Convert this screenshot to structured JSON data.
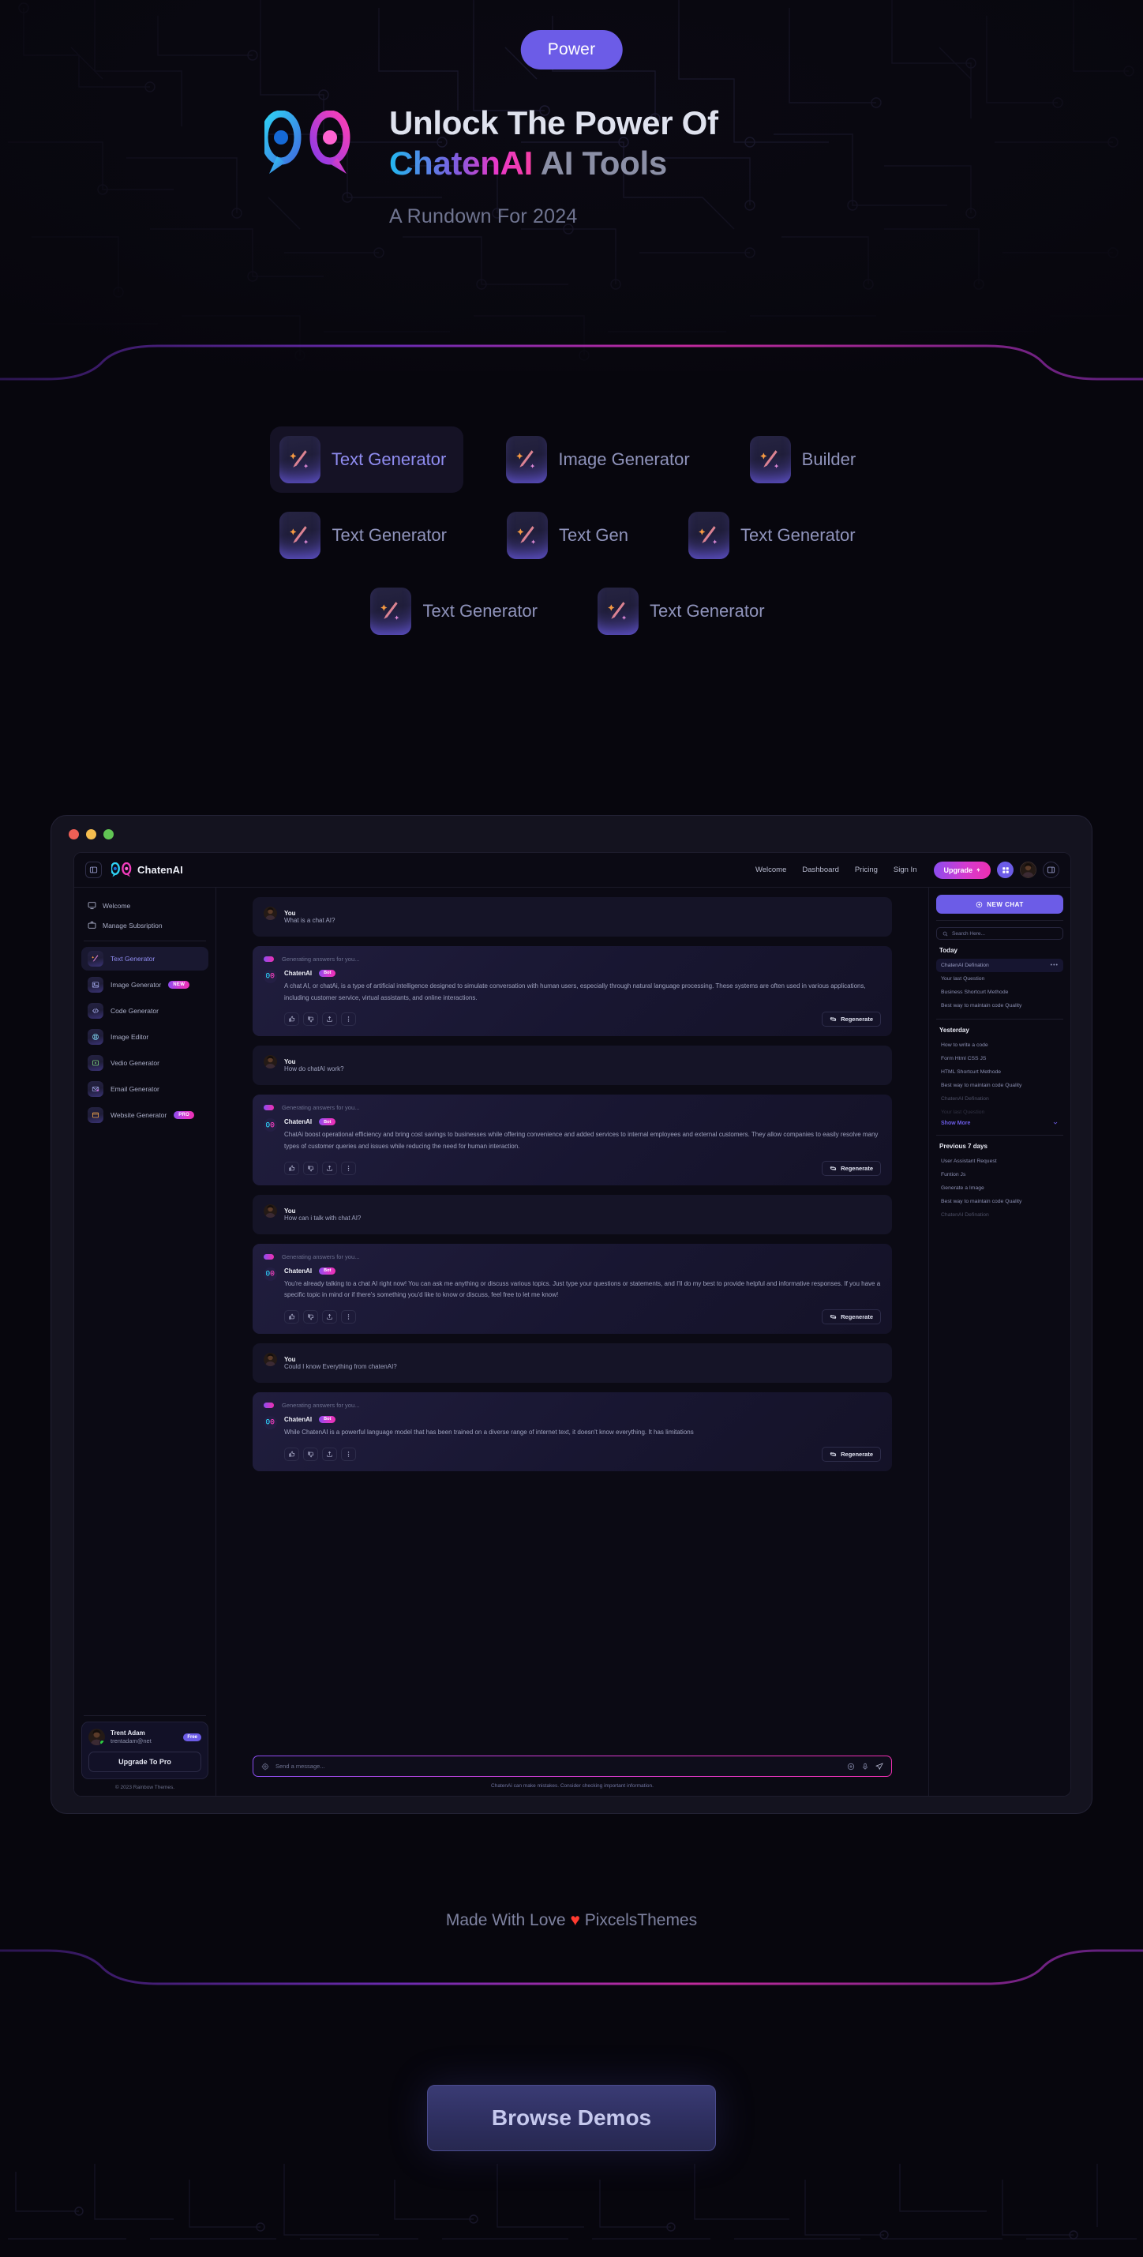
{
  "hero": {
    "badge": "Power",
    "title_line1": "Unlock The Power Of",
    "title_brand": "ChatenAI",
    "title_line2_rest": " AI Tools",
    "subtitle": "A Rundown For 2024",
    "logo_icon": "chatenai-logo-icon"
  },
  "features": {
    "row1": [
      {
        "label": "Text Generator",
        "icon": "magic-wand-icon",
        "active": true
      },
      {
        "label": "Image Generator",
        "icon": "magic-wand-icon",
        "active": false
      },
      {
        "label": "Builder",
        "icon": "magic-wand-icon",
        "active": false
      }
    ],
    "row2": [
      {
        "label": "Text Generator",
        "icon": "magic-wand-icon",
        "active": false
      },
      {
        "label": "Text Gen",
        "icon": "magic-wand-icon",
        "active": false
      },
      {
        "label": "Text Generator",
        "icon": "magic-wand-icon",
        "active": false
      }
    ],
    "row3": [
      {
        "label": "Text Generator",
        "icon": "magic-wand-icon",
        "active": false
      },
      {
        "label": "Text Generator",
        "icon": "magic-wand-icon",
        "active": false
      }
    ]
  },
  "app": {
    "brand": "ChatenAI",
    "nav_links": [
      "Welcome",
      "Dashboard",
      "Pricing",
      "Sign In"
    ],
    "upgrade_label": "Upgrade",
    "sidebar": {
      "top_items": [
        {
          "label": "Welcome",
          "icon": "monitor-icon"
        },
        {
          "label": "Manage Subsription",
          "icon": "briefcase-icon"
        }
      ],
      "tools": [
        {
          "label": "Text Generator",
          "icon": "magic-wand-icon",
          "tag": "",
          "active": true
        },
        {
          "label": "Image Generator",
          "icon": "image-icon",
          "tag": "NEW",
          "active": false
        },
        {
          "label": "Code Generator",
          "icon": "code-icon",
          "tag": "",
          "active": false
        },
        {
          "label": "Image Editor",
          "icon": "palette-icon",
          "tag": "",
          "active": false
        },
        {
          "label": "Vedio Generator",
          "icon": "play-icon",
          "tag": "",
          "active": false
        },
        {
          "label": "Email Generator",
          "icon": "mail-icon",
          "tag": "",
          "active": false
        },
        {
          "label": "Website Generator",
          "icon": "window-icon",
          "tag": "PRO",
          "active": false
        }
      ],
      "profile": {
        "name": "Trent Adam",
        "email": "trentadam@net",
        "plan_badge": "Free",
        "upgrade_label": "Upgrade To Pro",
        "copyright": "© 2023 Rainbow Themes."
      }
    },
    "chat": {
      "generating_text": "Generating answers for you...",
      "you_label": "You",
      "bot_label": "ChatenAI",
      "bot_tag": "Bot",
      "regenerate_label": "Regenerate",
      "messages": [
        {
          "role": "user",
          "text": "What is a chat AI?"
        },
        {
          "role": "bot",
          "text": "A chat AI, or chatAi, is a type of artificial intelligence designed to simulate conversation with human users, especially through natural language processing. These systems are often used in various applications, including customer service, virtual assistants, and online interactions."
        },
        {
          "role": "user",
          "text": "How do chatAI work?"
        },
        {
          "role": "bot",
          "text": "ChatAi boost operational efficiency and bring cost savings to businesses while offering convenience and added services to internal employees and external customers. They allow companies to easily resolve many types of customer queries and issues while reducing the need for human interaction."
        },
        {
          "role": "user",
          "text": "How can i talk with chat AI?"
        },
        {
          "role": "bot",
          "text": "You're already talking to a chat AI right now! You can ask me anything or discuss various topics. Just type your questions or statements, and I'll do my best to provide helpful and informative responses. If you have a specific topic in mind or if there's something you'd like to know or discuss, feel free to let me know!"
        },
        {
          "role": "user",
          "text": "Could I know Everything from chatenAI?"
        },
        {
          "role": "bot",
          "text": "While ChatenAI is a powerful language model that has been trained on a diverse range of internet text, it doesn't know everything. It has limitations"
        }
      ],
      "composer_placeholder": "Send a message...",
      "disclaimer": "ChatenAi can make mistakes. Consider checking important information."
    },
    "history": {
      "new_chat_label": "NEW CHAT",
      "search_placeholder": "Search Here...",
      "show_more_label": "Show More",
      "groups": [
        {
          "title": "Today",
          "items": [
            {
              "label": "ChatenAI Defination",
              "active": true,
              "fade": 0
            },
            {
              "label": "Your last Question",
              "active": false,
              "fade": 0
            },
            {
              "label": "Business Shortcurt Methode",
              "active": false,
              "fade": 0
            },
            {
              "label": "Best way to maintain code Quality",
              "active": false,
              "fade": 0
            }
          ]
        },
        {
          "title": "Yesterday",
          "items": [
            {
              "label": "How to write a code",
              "active": false,
              "fade": 0
            },
            {
              "label": "Form Html CSS JS",
              "active": false,
              "fade": 0
            },
            {
              "label": "HTML Shortcurt Methode",
              "active": false,
              "fade": 0
            },
            {
              "label": "Best way to maintain code Quality",
              "active": false,
              "fade": 0
            },
            {
              "label": "ChatenAI Defination",
              "active": false,
              "fade": 1
            },
            {
              "label": "Your last Question",
              "active": false,
              "fade": 2
            }
          ]
        },
        {
          "title": "Previous 7 days",
          "items": [
            {
              "label": "User Assistant Request",
              "active": false,
              "fade": 0
            },
            {
              "label": "Funtion Js",
              "active": false,
              "fade": 0
            },
            {
              "label": "Generate a Image",
              "active": false,
              "fade": 0
            },
            {
              "label": "Best way to maintain code Quality",
              "active": false,
              "fade": 0
            },
            {
              "label": "ChatenAI Defination",
              "active": false,
              "fade": 1
            }
          ]
        }
      ]
    }
  },
  "footer": {
    "made_prefix": "Made With Love ",
    "made_heart": "♥",
    "made_suffix": " PixcelsThemes",
    "browse_label": "Browse Demos"
  },
  "colors": {
    "accent_purple": "#6c5ce7",
    "accent_pink": "#ee2fb0",
    "accent_cyan": "#22b8f0",
    "bg": "#07060d"
  }
}
